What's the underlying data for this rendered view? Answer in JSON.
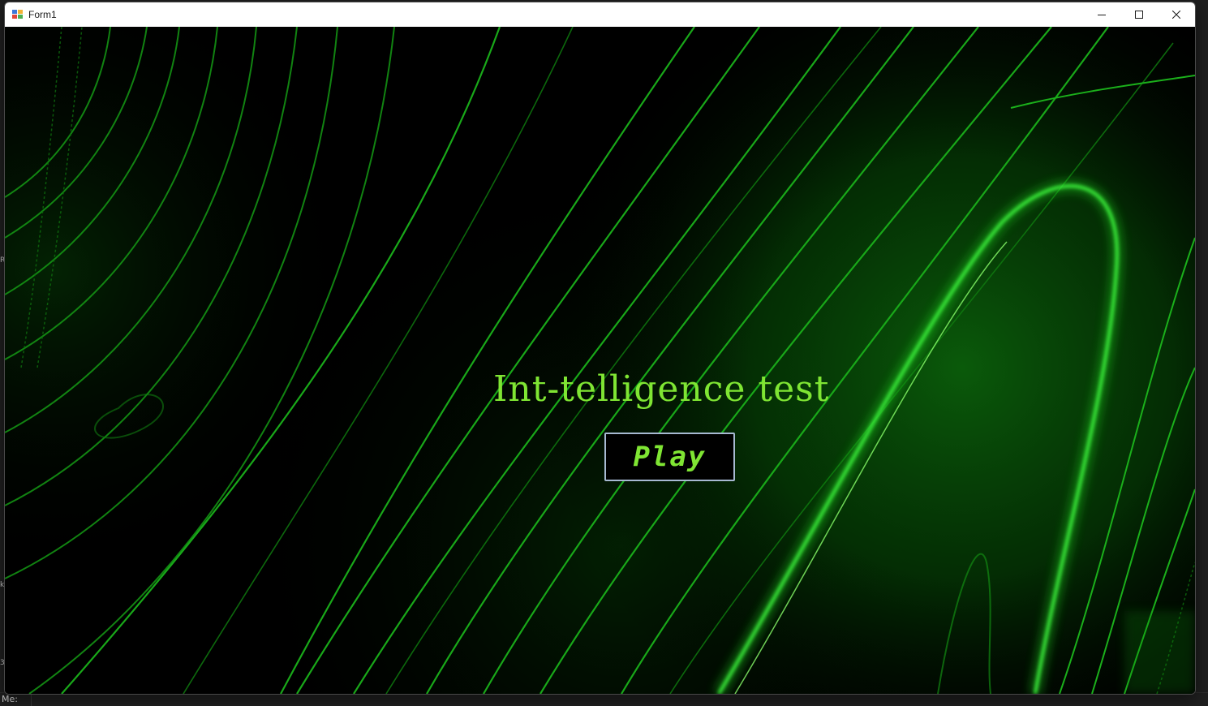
{
  "window": {
    "title": "Form1",
    "icon": "winforms-app-icon",
    "controls": {
      "minimize_icon": "minimize-icon",
      "maximize_icon": "maximize-icon",
      "close_icon": "close-icon"
    }
  },
  "form": {
    "heading": "Int-telligence test",
    "play_label": "Play",
    "background": "green-wave-lines",
    "colors": {
      "text": "#7fe533",
      "button_border": "#a7b9d2",
      "background": "#000000",
      "line_bright": "#2ee81f",
      "line_dim": "#0b6e0b"
    }
  },
  "desktop": {
    "taskbar_text": "Me:",
    "edge_glyphs": [
      "R",
      "k",
      "3"
    ]
  }
}
